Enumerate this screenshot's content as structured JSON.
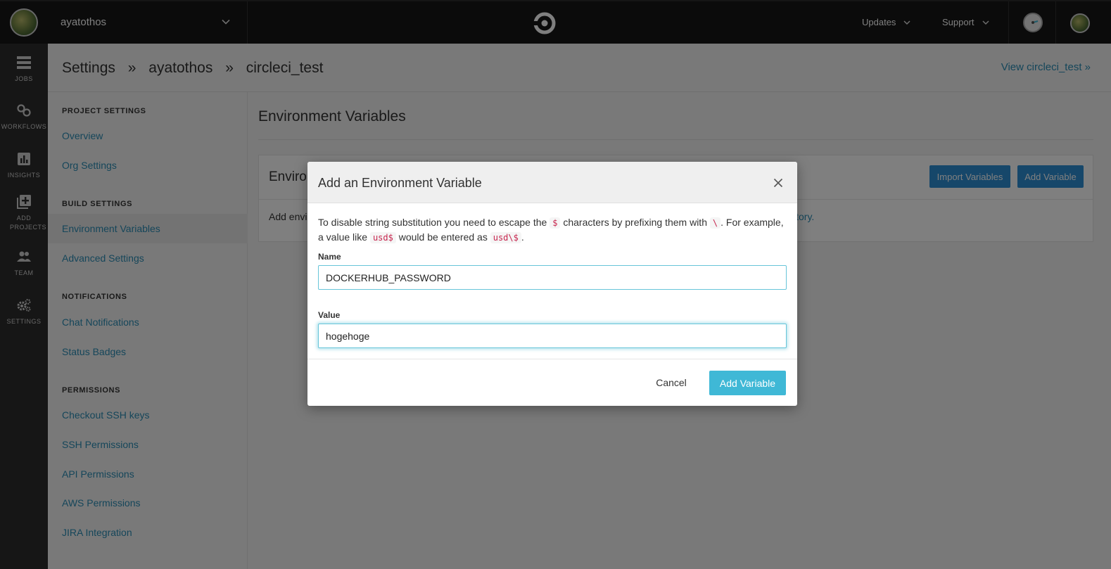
{
  "topbar": {
    "org_name": "ayatothos",
    "menu_updates": "Updates",
    "menu_support": "Support"
  },
  "leftnav": [
    {
      "label": "JOBS",
      "icon": "jobs-icon"
    },
    {
      "label": "WORKFLOWS",
      "icon": "workflows-icon"
    },
    {
      "label": "INSIGHTS",
      "icon": "insights-icon"
    },
    {
      "label": "ADD PROJECTS",
      "icon": "add-projects-icon"
    },
    {
      "label": "TEAM",
      "icon": "team-icon"
    },
    {
      "label": "SETTINGS",
      "icon": "settings-icon"
    }
  ],
  "breadcrumb": [
    "Settings",
    "»",
    "ayatothos",
    "»",
    "circleci_test"
  ],
  "view_link": "View circleci_test »",
  "sidebar": {
    "project_settings": "PROJECT SETTINGS",
    "overview": "Overview",
    "org_settings": "Org Settings",
    "build_settings": "BUILD SETTINGS",
    "environment_variables": "Environment Variables",
    "advanced_settings": "Advanced Settings",
    "notifications": "NOTIFICATIONS",
    "chat_notifications": "Chat Notifications",
    "status_badges": "Status Badges",
    "permissions": "PERMISSIONS",
    "checkout_ssh_keys": "Checkout SSH keys",
    "ssh_permissions": "SSH Permissions",
    "api_permissions": "API Permissions",
    "aws_permissions": "AWS Permissions",
    "jira_integration": "JIRA Integration"
  },
  "main": {
    "title": "Environment Variables",
    "card_title": "Environr",
    "import_button": "Import Variables",
    "add_button": "Add Variable",
    "card_text": "Add envi",
    "card_link": "itory."
  },
  "modal": {
    "title": "Add an Environment Variable",
    "desc": {
      "p1": "To disable string substitution you need to escape the ",
      "c1": "$",
      "p2": " characters by prefixing them with ",
      "c2": "\\",
      "p3": ". For example, a value like ",
      "c3": "usd$",
      "p4": " would be entered as ",
      "c4": "usd\\$",
      "p5": "."
    },
    "name_label": "Name",
    "name_value": "DOCKERHUB_PASSWORD",
    "value_label": "Value",
    "value_value": "hogehoge",
    "cancel": "Cancel",
    "add": "Add Variable"
  },
  "colors": {
    "topbar": "#161616",
    "leftnav": "#2c2c2c",
    "link": "#2a8cb5",
    "primary_button": "#2d8fd5",
    "modal_add_button": "#3fb8d6"
  }
}
